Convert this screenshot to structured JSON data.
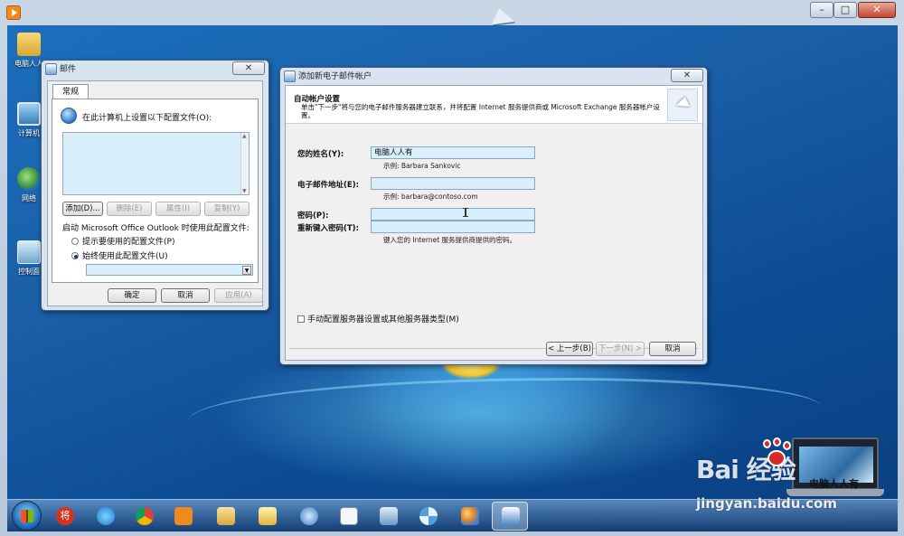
{
  "desktop": {
    "icons": [
      {
        "label": "电脑人人",
        "icon": "folder-icon"
      },
      {
        "label": "计算机",
        "icon": "computer-icon"
      },
      {
        "label": "网络",
        "icon": "network-icon"
      },
      {
        "label": "控制面",
        "icon": "control-panel-icon"
      }
    ]
  },
  "mail_window": {
    "title": "邮件",
    "close_glyph": "✕",
    "tab_general": "常规",
    "heading": "在此计算机上设置以下配置文件(O):",
    "add_button": "添加(D)...",
    "delete_button": "删除(E)",
    "properties_button": "属性(I)",
    "copy_button": "复制(Y)",
    "startup_label": "启动 Microsoft Office Outlook 时使用此配置文件:",
    "radio_prompt": "提示要使用的配置文件(P)",
    "radio_always": "始终使用此配置文件(U)",
    "selected_profile": "",
    "ok_button": "确定",
    "cancel_button": "取消",
    "apply_button": "应用(A)"
  },
  "wizard": {
    "title": "添加新电子邮件帐户",
    "close_glyph": "✕",
    "header_title": "自动帐户设置",
    "header_desc": "单击\"下一步\"将与您的电子邮件服务器建立联系，并将配置 Internet 服务提供商或 Microsoft Exchange 服务器帐户设置。",
    "name_label": "您的姓名(Y):",
    "name_value": "电脑人人有",
    "name_example": "示例: Barbara Sankovic",
    "email_label": "电子邮件地址(E):",
    "email_value": "",
    "email_example": "示例: barbara@contoso.com",
    "password_label": "密码(P):",
    "retype_label": "重新键入密码(T):",
    "password_hint": "键入您的 Internet 服务提供商提供的密码。",
    "manual_checkbox": "手动配置服务器设置或其他服务器类型(M)",
    "back_button": "< 上一步(B)",
    "next_button": "下一步(N) >",
    "cancel_button": "取消"
  },
  "taskbar": {
    "items": [
      "start-button",
      "jiang-app-icon",
      "ie-icon",
      "chrome-icon",
      "media-player-icon",
      "explorer-icon",
      "folder-app-icon",
      "edge-like-icon",
      "document-icon",
      "network-tool-icon",
      "pinwheel-icon",
      "paint-icon",
      "outlook-icon"
    ]
  },
  "taskbar_jiang_glyph": "将",
  "watermark": {
    "brand": "Bai  经验",
    "url": "jingyan.baidu.com",
    "caption": "电脑人人有"
  },
  "colors": {
    "wallpaper": "#1a5fa8",
    "field_bg": "#d9eefb",
    "window_frame": "#d8e4f1"
  }
}
